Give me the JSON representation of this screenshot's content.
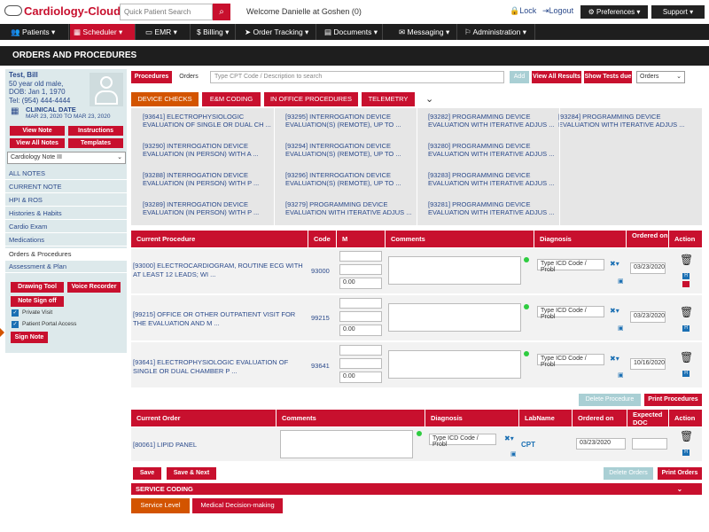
{
  "header": {
    "logo": "Cardiology-Cloud",
    "search_placeholder": "Quick Patient Search",
    "welcome": "Welcome Danielle at Goshen (0)",
    "lock": "Lock",
    "logout": "Logout",
    "preferences": "Preferences ▾",
    "support": "Support ▾"
  },
  "nav": [
    "Patients ▾",
    "Scheduler ▾",
    "EMR ▾",
    "Billing ▾",
    "Order Tracking ▾",
    "Documents ▾",
    "Messaging ▾",
    "Administration ▾"
  ],
  "section_title": "ORDERS AND PROCEDURES",
  "patient": {
    "name": "Test, Bill",
    "age": "50 year old male,",
    "dob": "DOB: Jan 1, 1970",
    "tel": "Tel: (954) 444-4444",
    "clinical_date_label": "CLINICAL DATE",
    "clinical_date_range": "MAR 23, 2020 TO MAR 23, 2020"
  },
  "left_buttons": {
    "view_note": "View Note",
    "instructions": "Instructions",
    "view_all_notes": "View All Notes",
    "templates": "Templates"
  },
  "note_select": "Cardiology Note III",
  "left_menu": [
    "ALL NOTES",
    "CURRENT NOTE",
    "HPI & ROS",
    "Histories & Habits",
    "Cardio Exam",
    "Medications",
    "Orders & Procedures",
    "Assessment & Plan"
  ],
  "left_bottom": {
    "drawing_tool": "Drawing Tool",
    "voice_recorder": "Voice Recorder",
    "note_sign_off": "Note Sign off",
    "private_visit": "Private Visit",
    "patient_portal": "Patient Portal Access",
    "sign_note": "Sign Note"
  },
  "toolbar": {
    "procedures": "Procedures",
    "orders": "Orders",
    "cpt_placeholder": "Type CPT Code / Description to search",
    "add": "Add",
    "view_all_results": "View All Results",
    "show_tests_due": "Show Tests due",
    "select_value": "Orders"
  },
  "cat_tabs": [
    "DEVICE CHECKS",
    "E&M CODING",
    "IN OFFICE PROCEDURES",
    "TELEMETRY"
  ],
  "checks": [
    [
      "[93641] ELECTROPHYSIOLOGIC EVALUATION OF SINGLE OR DUAL CH ...",
      "[93295] INTERROGATION DEVICE EVALUATION(S) (REMOTE), UP TO ...",
      "[93282] PROGRAMMING DEVICE EVALUATION WITH ITERATIVE ADJUS ...",
      "[93284] PROGRAMMING DEVICE EVALUATION WITH ITERATIVE ADJUS ..."
    ],
    [
      "[93290] INTERROGATION DEVICE EVALUATION (IN PERSON) WITH A ...",
      "[93294] INTERROGATION DEVICE EVALUATION(S) (REMOTE), UP TO ...",
      "[93280] PROGRAMMING DEVICE EVALUATION WITH ITERATIVE ADJUS ...",
      ""
    ],
    [
      "[93288] INTERROGATION DEVICE EVALUATION (IN PERSON) WITH P ...",
      "[93296] INTERROGATION DEVICE EVALUATION(S) (REMOTE), UP TO ...",
      "[93283] PROGRAMMING DEVICE EVALUATION WITH ITERATIVE ADJUS ...",
      ""
    ],
    [
      "[93289] INTERROGATION DEVICE EVALUATION (IN PERSON) WITH P ...",
      "[93279] PROGRAMMING DEVICE EVALUATION WITH ITERATIVE ADJUS ...",
      "[93281] PROGRAMMING DEVICE EVALUATION WITH ITERATIVE ADJUS ...",
      ""
    ]
  ],
  "proc_table": {
    "headers": [
      "Current Procedure",
      "Code",
      "M",
      "Comments",
      "Diagnosis",
      "Ordered on",
      "Action"
    ],
    "icd_placeholder": "Type ICD Code / Probl",
    "rows": [
      {
        "name": "[93000] ELECTROCARDIOGRAM, ROUTINE ECG WITH AT LEAST 12 LEADS; WI ...",
        "code": "93000",
        "m": "0.00",
        "date": "03/23/2020"
      },
      {
        "name": "[99215] OFFICE OR OTHER OUTPATIENT VISIT FOR THE EVALUATION AND M ...",
        "code": "99215",
        "m": "0.00",
        "date": "03/23/2020"
      },
      {
        "name": "[93641] ELECTROPHYSIOLOGIC EVALUATION OF SINGLE OR DUAL CHAMBER P ...",
        "code": "93641",
        "m": "0.00",
        "date": "10/16/2020"
      }
    ],
    "delete_label": "Delete Procedure",
    "print_label": "Print Procedures"
  },
  "order_table": {
    "headers": [
      "Current Order",
      "Comments",
      "Diagnosis",
      "LabName",
      "Ordered on",
      "Expected DOC",
      "Action"
    ],
    "rows": [
      {
        "name": "[80061] LIPID PANEL",
        "lab": "CPT",
        "date": "03/23/2020"
      }
    ],
    "delete_label": "Delete Orders",
    "print_label": "Print Orders"
  },
  "save": "Save",
  "save_next": "Save & Next",
  "service_coding": "SERVICE CODING",
  "service_tabs": [
    "Service Level",
    "Medical Decision-making"
  ],
  "badge_h": "H"
}
